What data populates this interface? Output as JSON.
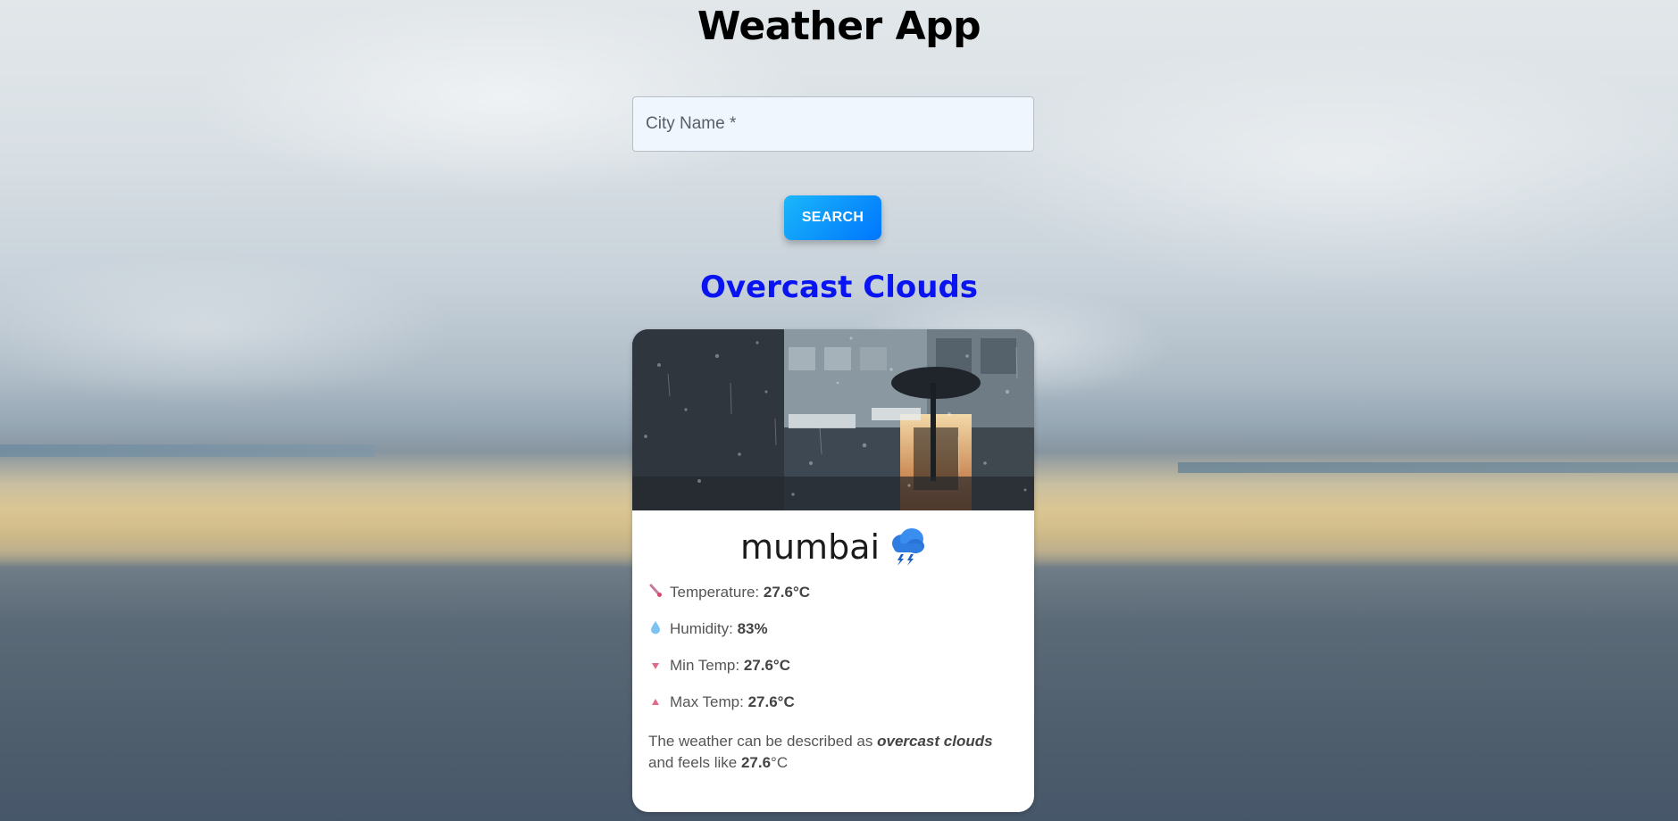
{
  "app": {
    "title": "Weather App"
  },
  "search": {
    "placeholder": "City Name *",
    "button_label": "SEARCH"
  },
  "condition": {
    "heading": "Overcast Clouds"
  },
  "card": {
    "city": "mumbai",
    "weather_icon": "thunder-rain-cloud-icon",
    "details": [
      {
        "icon": "thermometer-icon",
        "label": "Temperature: ",
        "value": "27.6°C"
      },
      {
        "icon": "droplet-icon",
        "label": "Humidity: ",
        "value": "83%"
      },
      {
        "icon": "triangle-down-icon",
        "label": "Min Temp: ",
        "value": "27.6°C"
      },
      {
        "icon": "triangle-up-icon",
        "label": "Max Temp: ",
        "value": "27.6°C"
      }
    ],
    "description": {
      "prefix": "The weather can be described as ",
      "condition": "overcast clouds",
      "middle": " and feels like ",
      "feels_like": "27.6",
      "unit": "°C"
    }
  },
  "colors": {
    "heading_blue": "#0a14f0",
    "button_start": "#1bb7fb",
    "button_end": "#0076ff",
    "field_bg": "#eff6fd"
  }
}
